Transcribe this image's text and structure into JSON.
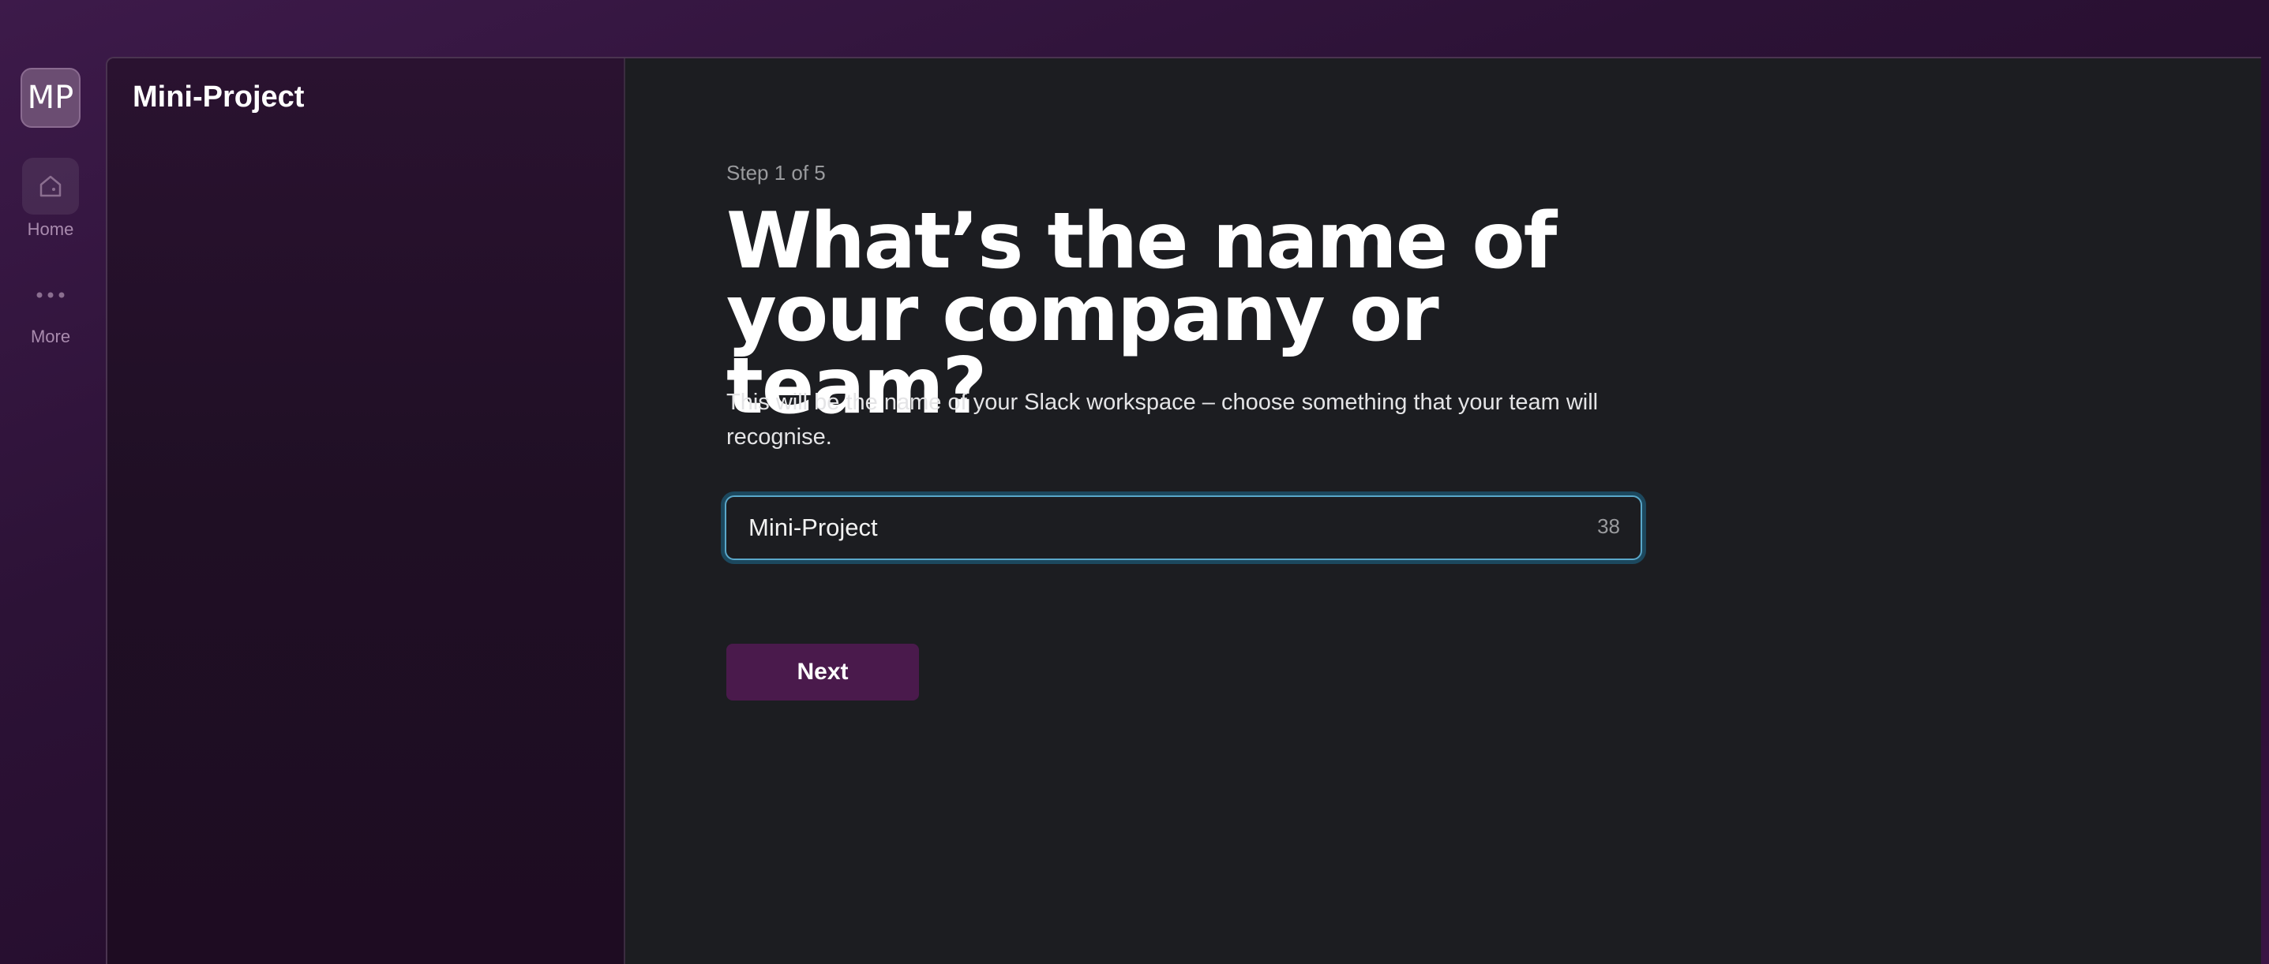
{
  "rail": {
    "workspace_initials": "MP",
    "items": [
      {
        "label": "Home",
        "icon": "home-icon"
      },
      {
        "label": "More",
        "icon": "more-dots-icon"
      }
    ]
  },
  "sidebar": {
    "workspace_name": "Mini-Project"
  },
  "setup": {
    "step": "Step 1 of 5",
    "heading": "What’s the name of your company or team?",
    "description": "This will be the name of your Slack workspace – choose something that your team will recognise.",
    "input_value": "Mini-Project",
    "char_counter": "38",
    "next_label": "Next"
  },
  "colors": {
    "accent_focus": "#1d9bd1",
    "button": "#4a1a4c",
    "main_bg": "#1c1d21"
  }
}
